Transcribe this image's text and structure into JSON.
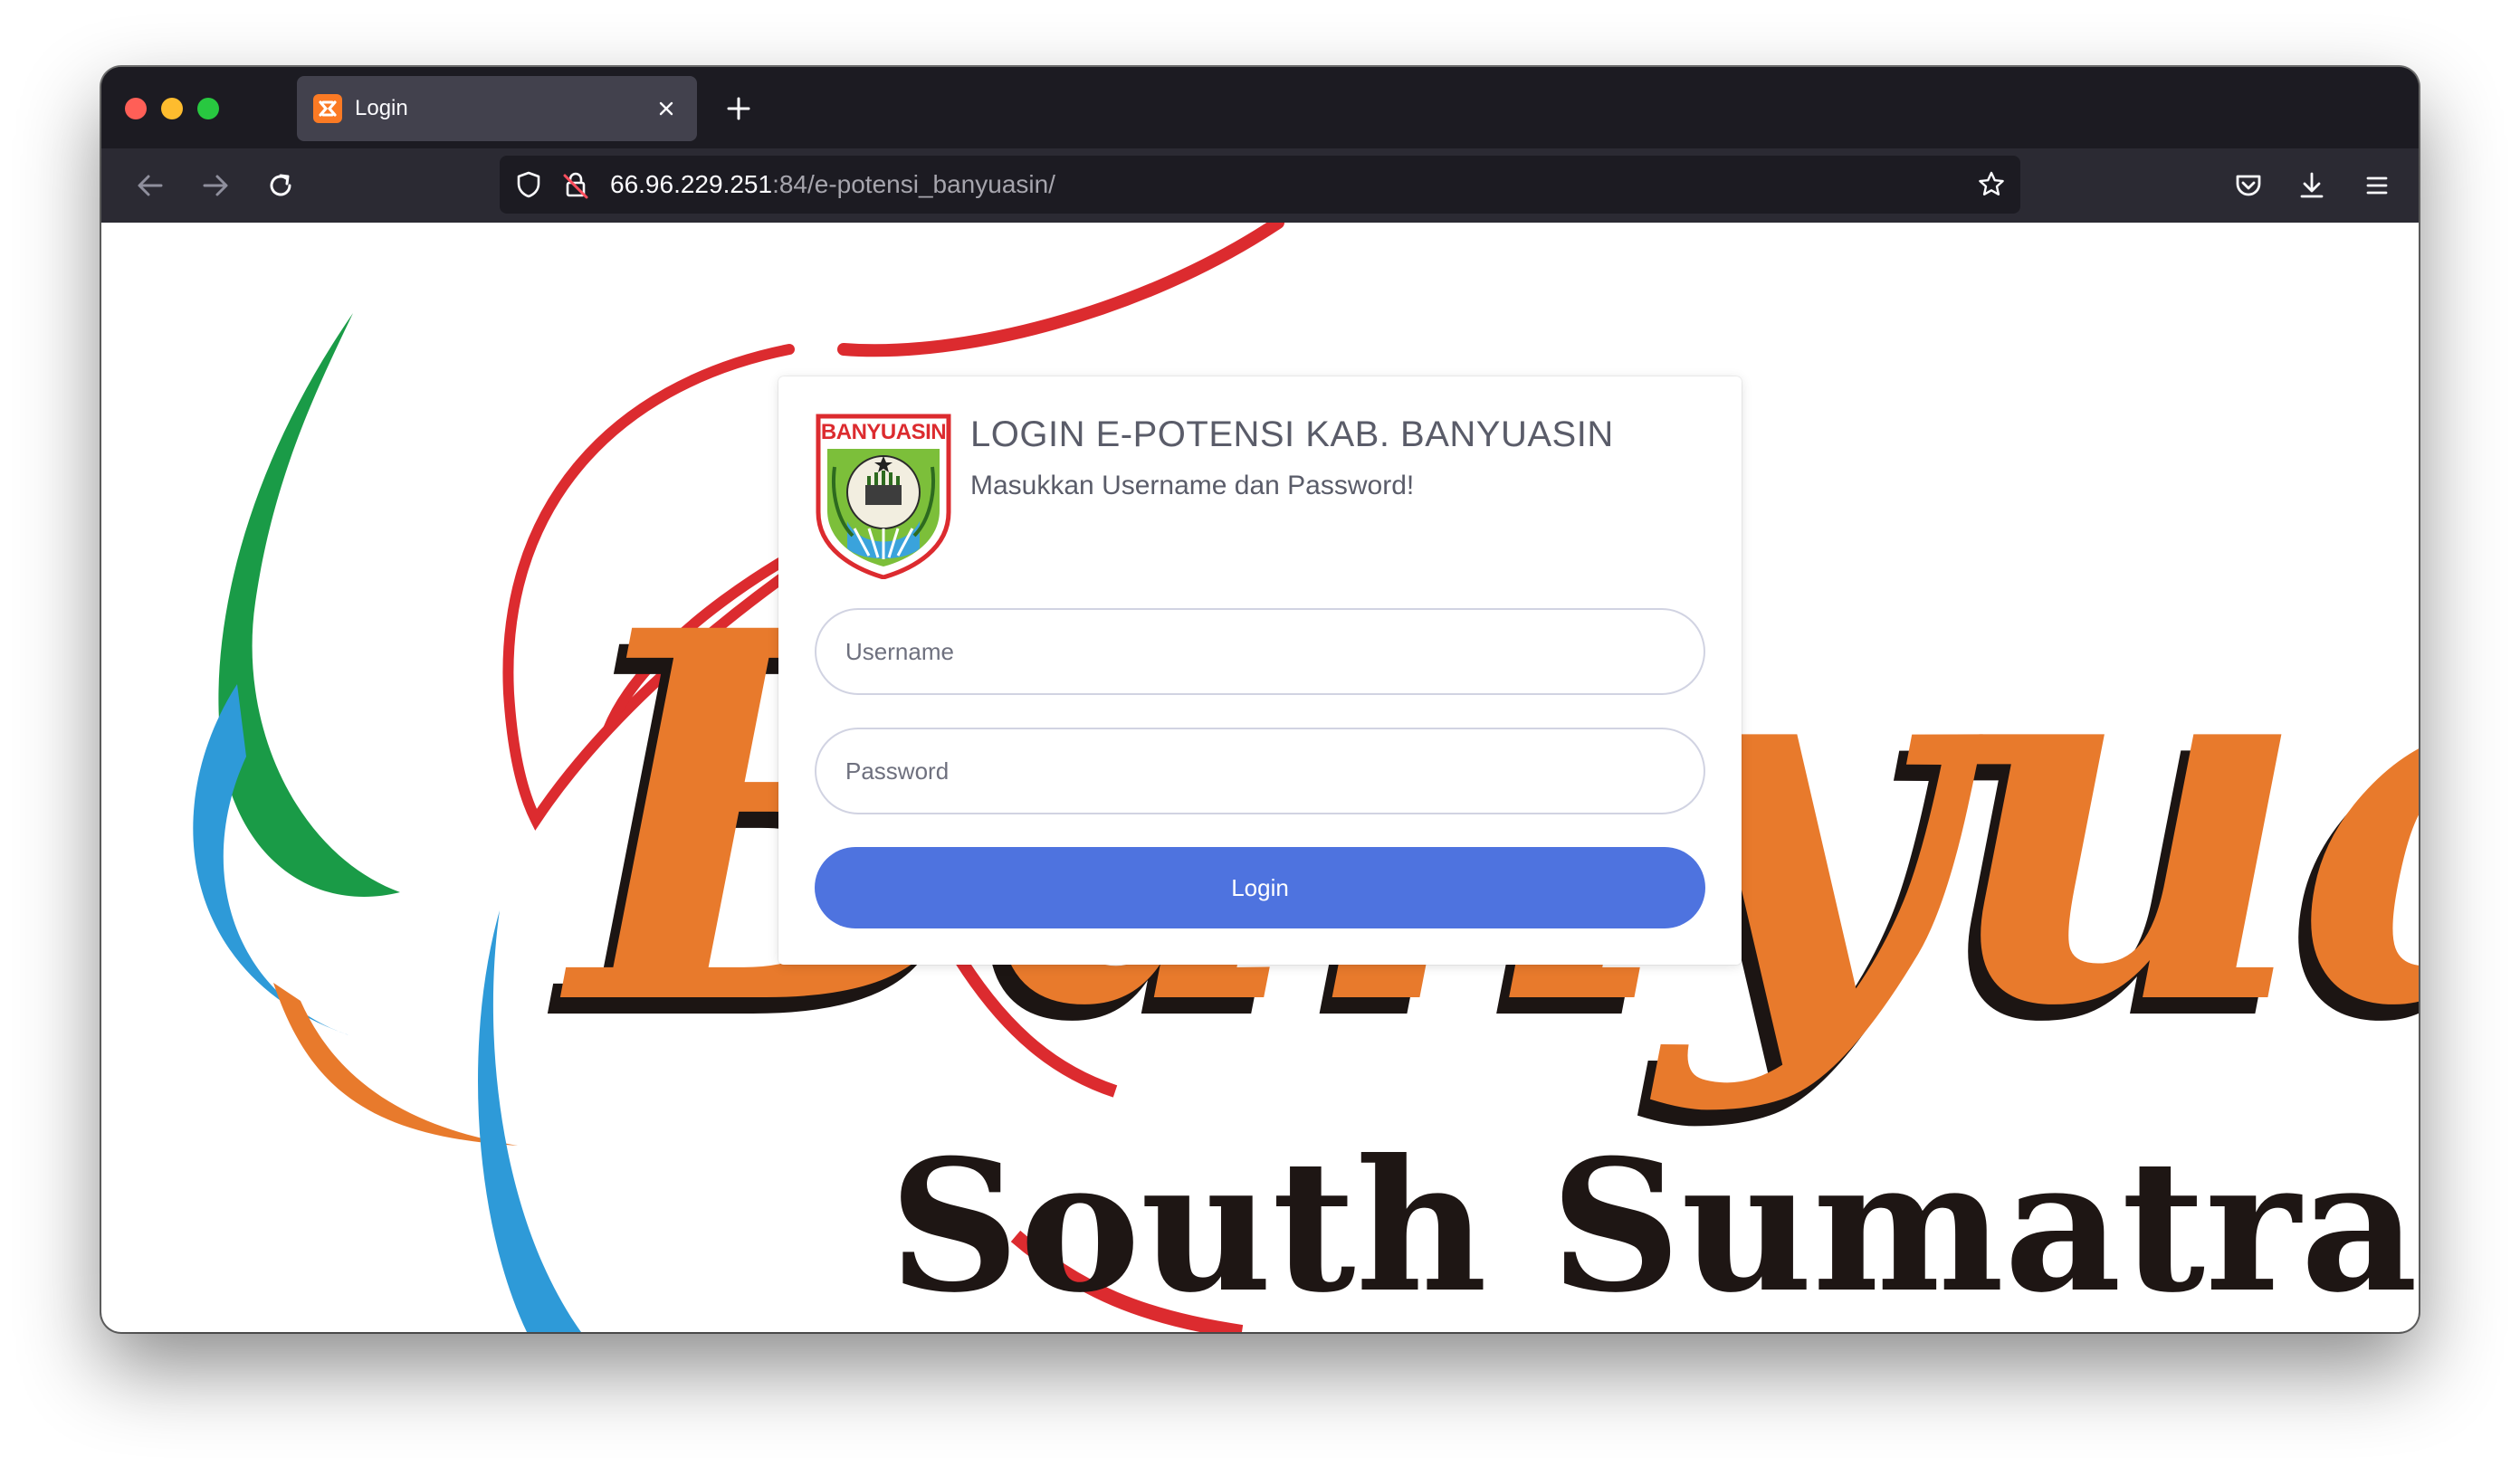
{
  "browser": {
    "tab": {
      "title": "Login",
      "favicon": "xampp-favicon-icon"
    },
    "url": {
      "host": "66.96.229.251",
      "rest": ":84/e-potensi_banyuasin/"
    },
    "icons": {
      "back": "arrow-left-icon",
      "forward": "arrow-right-icon",
      "reload": "reload-icon",
      "shield": "shield-icon",
      "insecure_lock": "insecure-lock-icon",
      "bookmark": "star-icon",
      "pocket": "pocket-icon",
      "downloads": "download-icon",
      "menu": "hamburger-menu-icon",
      "new_tab": "plus-icon",
      "close_tab": "close-icon"
    }
  },
  "background": {
    "title": "Banyuasin",
    "subtitle": "South Sumatra",
    "colors": {
      "orange": "#e87a2c",
      "red": "#dc2b2f",
      "green": "#1a9b47",
      "blue": "#2e9ad8",
      "dark": "#1e1614"
    }
  },
  "login": {
    "logo_text": "BANYUASIN",
    "title": "LOGIN E-POTENSI KAB. BANYUASIN",
    "subtitle": "Masukkan Username dan Password!",
    "username_placeholder": "Username",
    "password_placeholder": "Password",
    "button_label": "Login",
    "button_color": "#4e73df"
  }
}
